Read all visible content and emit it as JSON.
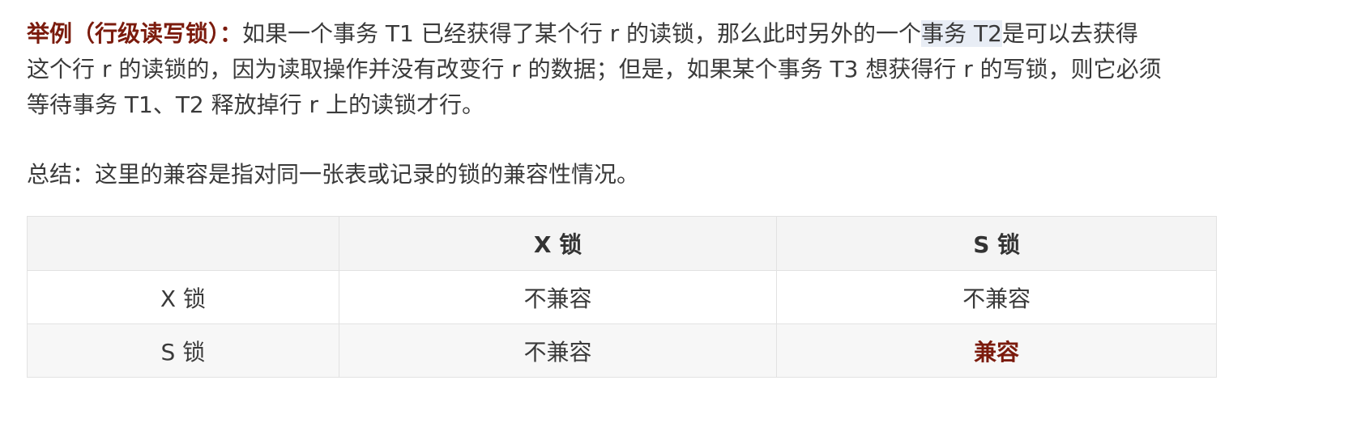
{
  "paragraph": {
    "label": "举例（行级读写锁）：",
    "line1_text": "如果一个事务 T1 已经获得了某个行 r 的读锁，那么此时另外的一个",
    "line1_highlight": "事务 T2",
    "line1_tail": "是可以去获得",
    "line2": "这个行 r 的读锁的，因为读取操作并没有改变行 r 的数据；但是，如果某个事务 T3 想获得行 r 的写锁，则它必须",
    "line3": "等待事务 T1、T2 释放掉行 r 上的读锁才行。"
  },
  "summary": "总结：这里的兼容是指对同一张表或记录的锁的兼容性情况。",
  "table": {
    "headers": [
      "",
      "X 锁",
      "S 锁"
    ],
    "rows": [
      {
        "label": "X 锁",
        "cells": [
          "不兼容",
          "不兼容"
        ]
      },
      {
        "label": "S 锁",
        "cells": [
          "不兼容",
          "兼容"
        ]
      }
    ],
    "highlight_color": "#7b1b0d"
  }
}
